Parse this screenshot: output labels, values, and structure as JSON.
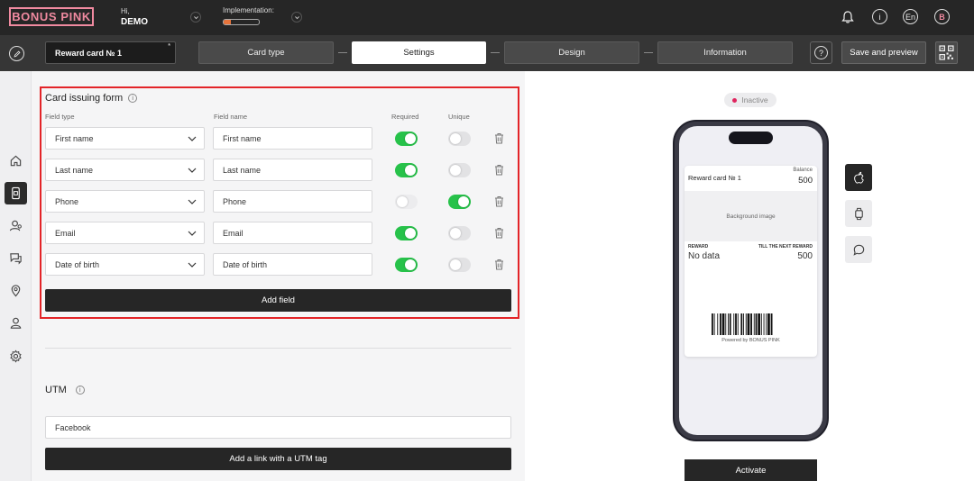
{
  "header": {
    "logo_text": "BONUS PINK",
    "greeting": "Hi,",
    "user_name": "DEMO",
    "implementation_label": "Implementation:",
    "implementation_progress": 0.2,
    "language": "En",
    "avatar_letter": "B"
  },
  "toolbar": {
    "card_name": "Reward card № 1",
    "card_name_marker": "*",
    "steps": [
      "Card type",
      "Settings",
      "Design",
      "Information"
    ],
    "active_step": "Settings",
    "help_label": "?",
    "save_label": "Save and preview"
  },
  "form": {
    "title": "Card issuing form",
    "col_field_type": "Field type",
    "col_field_name": "Field name",
    "col_required": "Required",
    "col_unique": "Unique",
    "rows": [
      {
        "type": "First name",
        "name": "First name",
        "required": true,
        "unique": false
      },
      {
        "type": "Last name",
        "name": "Last name",
        "required": true,
        "unique": false
      },
      {
        "type": "Phone",
        "name": "Phone",
        "required": true,
        "unique": true
      },
      {
        "type": "Email",
        "name": "Email",
        "required": true,
        "unique": false
      },
      {
        "type": "Date of birth",
        "name": "Date of birth",
        "required": true,
        "unique": false
      }
    ],
    "add_field_label": "Add field"
  },
  "utm": {
    "title": "UTM",
    "value": "Facebook",
    "add_link_label": "Add a link with a UTM tag"
  },
  "preview": {
    "status": "Inactive",
    "card_title": "Reward card № 1",
    "balance_label": "Balance",
    "balance_value": "500",
    "background_label": "Background image",
    "reward_label": "REWARD",
    "reward_value": "No data",
    "next_reward_label": "TILL THE NEXT REWARD",
    "next_reward_value": "500",
    "powered_by": "Powered by BONUS PINK",
    "activate_label": "Activate"
  },
  "colors": {
    "accent_pink": "#f08aa0",
    "toggle_on": "#27c24a",
    "highlight_red": "#e32428",
    "progress_orange": "#e8743b",
    "status_dot": "#e0245e"
  }
}
